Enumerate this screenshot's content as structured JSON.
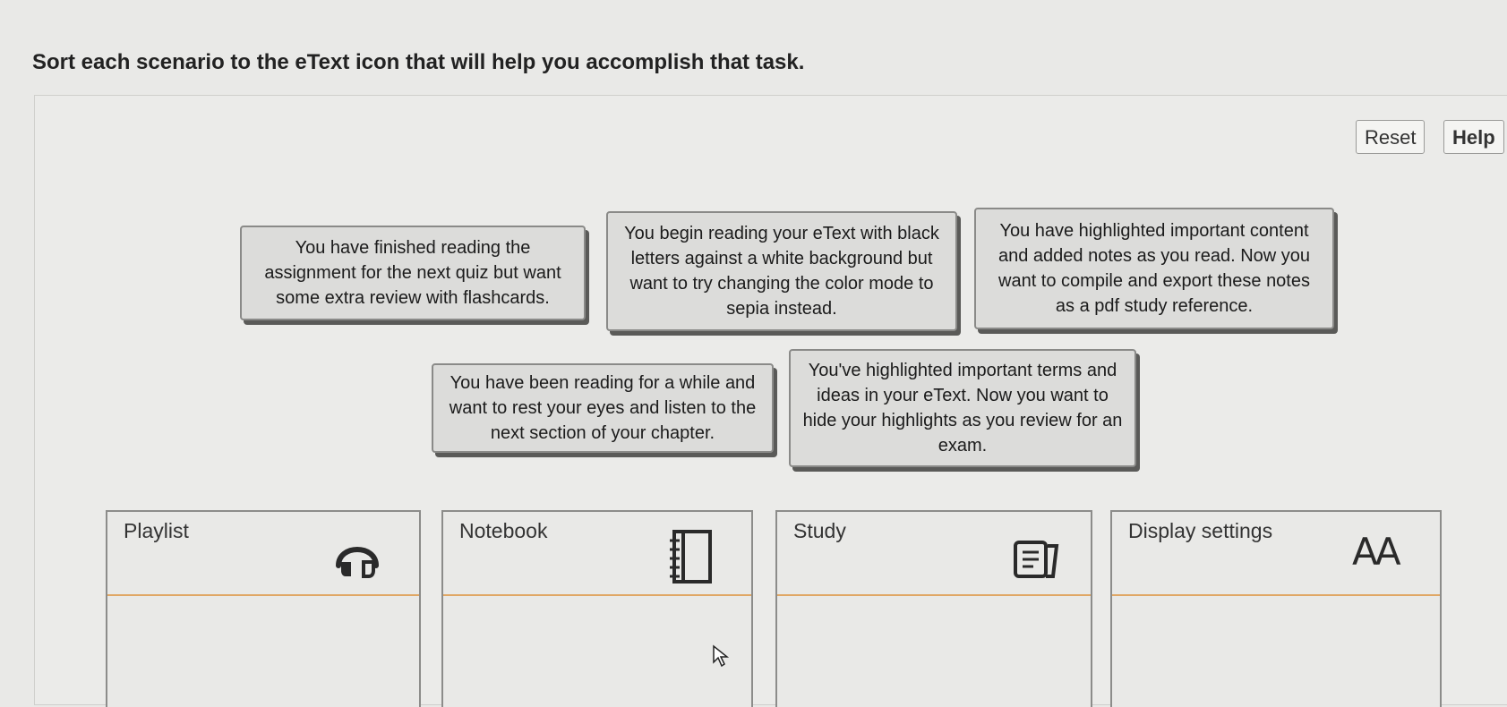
{
  "instruction": "Sort each scenario to the eText icon that will help you accomplish that task.",
  "buttons": {
    "reset": "Reset",
    "help": "Help"
  },
  "scenarios": [
    {
      "text": "You have finished reading the assignment for the next quiz but want some extra review with flashcards."
    },
    {
      "text": "You begin reading your eText with black letters against a white background but want to try changing the color mode to sepia instead."
    },
    {
      "text": "You have highlighted important content and added notes as you read. Now you want to compile and export these notes as a pdf study reference."
    },
    {
      "text": "You have been reading for a while and want to rest your eyes and listen to the next section of your chapter."
    },
    {
      "text": "You've highlighted important terms and ideas in your eText. Now you want to hide your highlights as you review for an exam."
    }
  ],
  "bins": [
    {
      "label": "Playlist",
      "icon": "headphones-icon"
    },
    {
      "label": "Notebook",
      "icon": "notebook-icon"
    },
    {
      "label": "Study",
      "icon": "study-cards-icon"
    },
    {
      "label": "Display settings",
      "icon": "text-size-icon",
      "icon_text": "AA"
    }
  ]
}
